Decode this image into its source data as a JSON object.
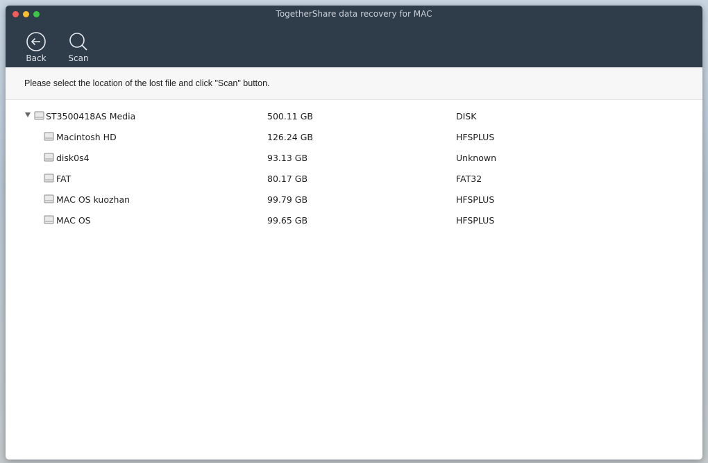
{
  "window": {
    "title": "TogetherShare data recovery for MAC"
  },
  "toolbar": {
    "back_label": "Back",
    "scan_label": "Scan"
  },
  "instruction": "Please select the location of the lost file and click \"Scan\" button.",
  "tree": {
    "root": {
      "name": "ST3500418AS Media",
      "size": "500.11 GB",
      "type": "DISK"
    },
    "children": [
      {
        "name": "Macintosh HD",
        "size": "126.24 GB",
        "type": "HFSPLUS"
      },
      {
        "name": "disk0s4",
        "size": "93.13 GB",
        "type": "Unknown"
      },
      {
        "name": "FAT",
        "size": "80.17 GB",
        "type": "FAT32"
      },
      {
        "name": "MAC OS kuozhan",
        "size": "99.79 GB",
        "type": "HFSPLUS"
      },
      {
        "name": "MAC OS",
        "size": "99.65 GB",
        "type": "HFSPLUS"
      }
    ]
  },
  "colors": {
    "titlebar": "#2f3c4a",
    "close": "#f25f58",
    "minimize": "#f8be2f",
    "zoom": "#3dc645"
  },
  "icons": {
    "back": "back-circle-arrow-icon",
    "scan": "magnifier-icon",
    "drive": "hard-drive-icon",
    "expand": "disclosure-triangle-icon"
  }
}
